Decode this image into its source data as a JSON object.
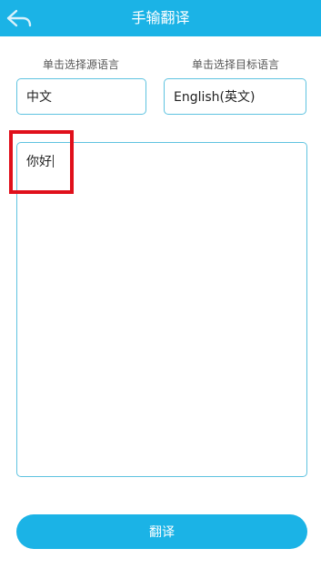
{
  "header": {
    "title": "手输翻译",
    "back_icon": "back-arrow-icon"
  },
  "source_language": {
    "label": "单击选择源语言",
    "value": "中文"
  },
  "target_language": {
    "label": "单击选择目标语言",
    "value": "English(英文)"
  },
  "input": {
    "value": "你好"
  },
  "translate_button": {
    "label": "翻译"
  },
  "colors": {
    "accent": "#1bb3e6",
    "border": "#5fc3e0",
    "highlight": "#e0101b"
  }
}
